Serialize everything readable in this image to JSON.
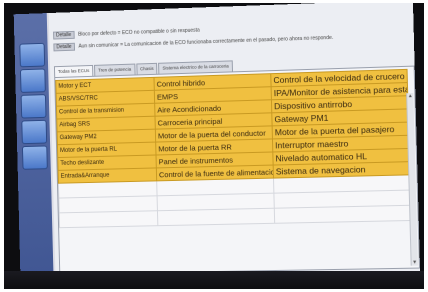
{
  "status": [
    {
      "tag": "Detalle",
      "text": "Bloco por defecto = ECO no compatible o sin respuesta"
    },
    {
      "tag": "Detalle",
      "text": "Aun sin comunicar = La comunicacion de la ECO funcionaba correctamente en el pasado, pero ahora no responde."
    }
  ],
  "tabs": [
    "Todas las ECUs",
    "Tren de potencia",
    "Chasis",
    "Sistema electrico de la carroceria"
  ],
  "table": {
    "rows": [
      [
        "Motor y ECT",
        "Control hibrido",
        "Control de la velocidad de crucero"
      ],
      [
        "ABS/VSC/TRC",
        "EMPS",
        "IPA/Monitor de asistencia para estacionar"
      ],
      [
        "Control de la transmision",
        "Aire Acondicionado",
        "Dispositivo antirrobo"
      ],
      [
        "Airbag SRS",
        "Carroceria principal",
        "Gateway PM1"
      ],
      [
        "Gateway PM2",
        "Motor de la puerta del conductor",
        "Motor de la puerta del pasajero"
      ],
      [
        "Motor de la puerta RL",
        "Motor de la puerta RR",
        "Interruptor maestro"
      ],
      [
        "Techo deslizante",
        "Panel de instrumentos",
        "Nivelado automatico HL"
      ],
      [
        "Entrada&Arranque",
        "Control de la fuente de alimentacion electrica",
        "Sistema de navegacion"
      ]
    ]
  },
  "colors": {
    "cell_fill": "#f0c040",
    "sidebar": "#4b5f9e",
    "screen_bg": "#dcdde6"
  }
}
